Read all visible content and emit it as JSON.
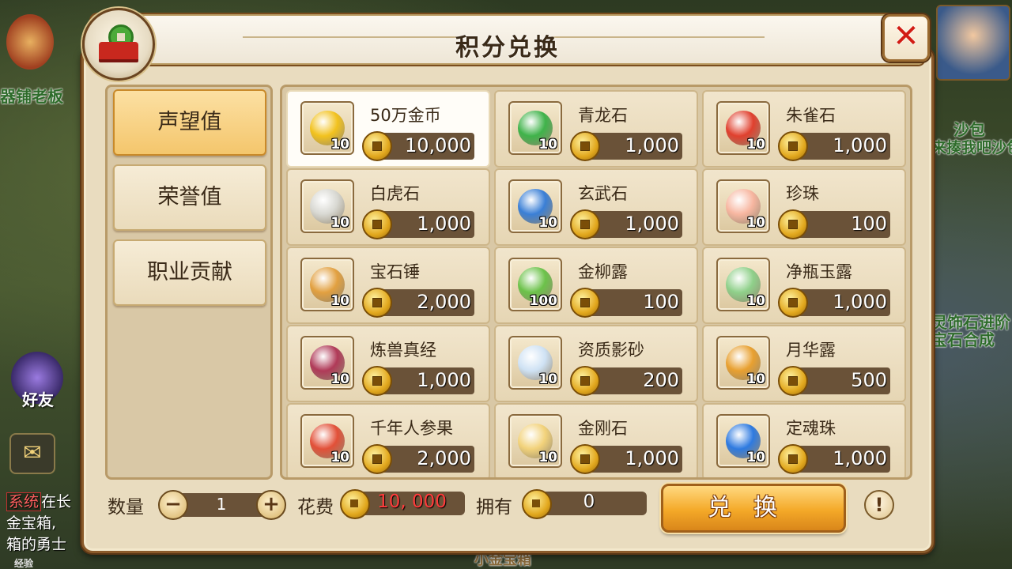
{
  "background": {
    "npc_left_label": "器铺老板",
    "npc_right_label1": "沙包",
    "npc_right_label2": "来揍我吧沙包",
    "right_hint1": "灵饰石进阶",
    "right_hint2": "宝石合成",
    "friend_label": "好友",
    "chat_tag": "系统",
    "chat_line1": "在长",
    "chat_line2": "金宝箱,",
    "chat_line3": "箱的勇士",
    "bottom_text": "小金宝箱",
    "exp_label": "经验"
  },
  "panel": {
    "title": "积分兑换",
    "close_label": "✕"
  },
  "tabs": [
    {
      "label": "声望值",
      "active": true
    },
    {
      "label": "荣誉值",
      "active": false
    },
    {
      "label": "职业贡献",
      "active": false
    }
  ],
  "items": [
    {
      "name": "50万金币",
      "qty": "10",
      "price": "10,000",
      "icon": "gold-coin-icon",
      "color": "#f2c21e",
      "selected": true
    },
    {
      "name": "青龙石",
      "qty": "10",
      "price": "1,000",
      "icon": "green-dragon-stone-icon",
      "color": "#3fb34a"
    },
    {
      "name": "朱雀石",
      "qty": "10",
      "price": "1,000",
      "icon": "vermilion-bird-stone-icon",
      "color": "#e0402e"
    },
    {
      "name": "白虎石",
      "qty": "10",
      "price": "1,000",
      "icon": "white-tiger-stone-icon",
      "color": "#d8d8d2"
    },
    {
      "name": "玄武石",
      "qty": "10",
      "price": "1,000",
      "icon": "black-tortoise-stone-icon",
      "color": "#3a7fd6"
    },
    {
      "name": "珍珠",
      "qty": "10",
      "price": "100",
      "icon": "pearl-icon",
      "color": "#f7b6a0"
    },
    {
      "name": "宝石锤",
      "qty": "10",
      "price": "2,000",
      "icon": "gem-hammer-icon",
      "color": "#e2a040"
    },
    {
      "name": "金柳露",
      "qty": "100",
      "price": "100",
      "icon": "willow-dew-icon",
      "color": "#6cc24a"
    },
    {
      "name": "净瓶玉露",
      "qty": "10",
      "price": "1,000",
      "icon": "jade-vase-dew-icon",
      "color": "#8fd08a"
    },
    {
      "name": "炼兽真经",
      "qty": "10",
      "price": "1,000",
      "icon": "beast-scripture-icon",
      "color": "#b03a58"
    },
    {
      "name": "资质影砂",
      "qty": "10",
      "price": "200",
      "icon": "crystal-ball-icon",
      "color": "#cfe2f4"
    },
    {
      "name": "月华露",
      "qty": "10",
      "price": "500",
      "icon": "moon-dew-gourd-icon",
      "color": "#e8a030"
    },
    {
      "name": "千年人参果",
      "qty": "10",
      "price": "2,000",
      "icon": "ginseng-fruit-icon",
      "color": "#e25038"
    },
    {
      "name": "金刚石",
      "qty": "10",
      "price": "1,000",
      "icon": "diamond-stone-icon",
      "color": "#f2d27a"
    },
    {
      "name": "定魂珠",
      "qty": "10",
      "price": "1,000",
      "icon": "soul-pearl-icon",
      "color": "#2e7ae0"
    }
  ],
  "footer": {
    "qty_label": "数量",
    "qty_minus": "−",
    "qty_value": "1",
    "qty_plus": "+",
    "cost_label": "花费",
    "cost_value": "10, 000",
    "own_label": "拥有",
    "own_value": "0",
    "exchange_label": "兑换",
    "info_label": "!"
  }
}
